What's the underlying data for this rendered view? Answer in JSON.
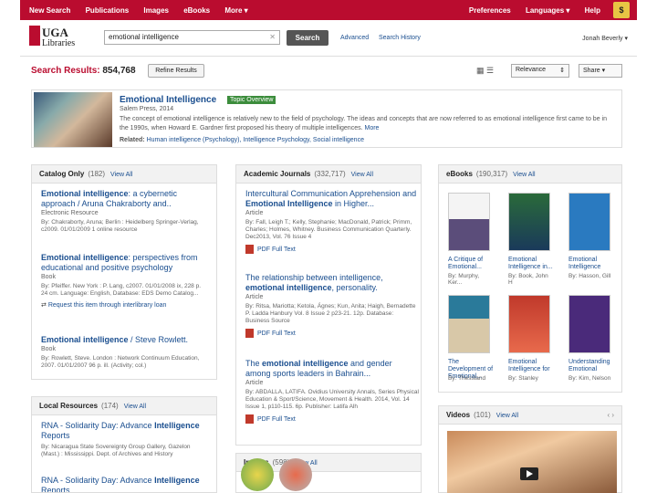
{
  "topnav": {
    "items": [
      "New Search",
      "Publications",
      "Images",
      "eBooks",
      "More ▾"
    ],
    "right": [
      "Preferences",
      "Languages ▾",
      "Help"
    ],
    "cart": "$"
  },
  "header": {
    "logo_line1": "UGA",
    "logo_line2": "Libraries",
    "search_value": "emotional intelligence",
    "search_button": "Search",
    "advanced": "Advanced",
    "history": "Search History",
    "user": "Jonah Beverly"
  },
  "results": {
    "label": "Search Results:",
    "count": "854,768",
    "refine": "Refine Results",
    "sort": "Relevance",
    "share": "Share ▾"
  },
  "topic": {
    "title": "Emotional Intelligence",
    "badge": "Topic Overview",
    "publisher": "Salem Press, 2014",
    "desc": "The concept of emotional intelligence is relatively new to the field of psychology. The ideas and concepts that are now referred to as emotional intelligence first came to be in the 1990s, when Howard E. Gardner first proposed his theory of multiple intelligences.",
    "more": "More",
    "related_label": "Related:",
    "related": "Human intelligence (Psychology), Intelligence Psychology, Social intelligence"
  },
  "catalog": {
    "title": "Catalog Only",
    "count": "(182)",
    "view_all": "View All",
    "items": [
      {
        "title_bold": "Emotional intelligence",
        "title_rest": ": a cybernetic approach / Aruna Chakraborty and..",
        "type": "Electronic Resource",
        "meta": "By: Chakraborty, Aruna; Berlin : Heidelberg Springer-Verlag, c2009. 01/01/2009 1 online resource"
      },
      {
        "title_bold": "Emotional intelligence",
        "title_rest": ": perspectives from educational and positive psychology",
        "type": "Book",
        "meta": "By: Pfeiffer. New York : P. Lang, c2007. 01/01/2008 ix, 228 p. 24 cm. Language: English, Database: EDS Demo Catalog...",
        "action": "Request this item through interlibrary loan"
      },
      {
        "title_bold": "Emotional intelligence",
        "title_rest": " / Steve Rowlett.",
        "type": "Book",
        "meta": "By: Rowlett, Steve. London : Network Continuum Education, 2007. 01/01/2007 96 p. ill. (Activity; col.)"
      }
    ]
  },
  "journals": {
    "title": "Academic Journals",
    "count": "(332,717)",
    "view_all": "View All",
    "items": [
      {
        "title_pre": "Intercultural Communication Apprehension and ",
        "title_bold": "Emotional Intelligence",
        "title_rest": " in Higher...",
        "type": "Article",
        "meta": "By: Fall, Leigh T.; Kelly, Stephanie; MacDonald, Patrick; Primm, Charles; Holmes, Whitney. Business Communication Quarterly. Dec2013, Vol. 76 Issue 4",
        "pdf": "PDF Full Text"
      },
      {
        "title_pre": "The relationship between intelligence, ",
        "title_bold": "emotional intelligence",
        "title_rest": ", personality.",
        "type": "Article",
        "meta": "By: Ritsa, Mariotta; Ketola, Ágnes; Kun, Anita; Haigh, Bernadette P. Ladda Hanbury Vol. 8 Issue 2 p23-21. 12p. Database: Business Source",
        "pdf": "PDF Full Text"
      },
      {
        "title_pre": "The ",
        "title_bold": "emotional intelligence",
        "title_rest": " and gender among sports leaders in Bahrain...",
        "type": "Article",
        "meta": "By: ABDALLA, LATIFA. Ovidius University Annals, Series Physical Education & Sport/Science, Movement & Health. 2014, Vol. 14 Issue 1, p110-115. 6p. Publisher: Latifa Alh",
        "pdf": "PDF Full Text"
      }
    ]
  },
  "ebooks": {
    "title": "eBooks",
    "count": "(190,317)",
    "view_all": "View All",
    "books": [
      {
        "cap": "A Critique of Emotional...",
        "by": "By: Murphy, Ker..."
      },
      {
        "cap": "Emotional Intelligence in...",
        "by": "By: Book, John H"
      },
      {
        "cap": "Emotional Intelligence",
        "by": "By: Hasson, Gill"
      },
      {
        "cap": "The Development of Emotional...",
        "by": "By: Thessland"
      },
      {
        "cap": "Emotional Intelligence for",
        "by": "By: Stanley"
      },
      {
        "cap": "Understanding Emotional",
        "by": "By: Kim, Nelson"
      }
    ]
  },
  "local": {
    "title": "Local Resources",
    "count": "(174)",
    "view_all": "View All",
    "items": [
      {
        "title_pre": "RNA - Solidarity Day: Advance ",
        "title_bold": "Intelligence",
        "title_rest": " Reports",
        "meta": "By: Nicaragua State Sovereignty Group Gallery, Gazelon (Mast.) : Mississippi. Dept. of Archives and History"
      },
      {
        "title_pre": "RNA - Solidarity Day: Advance ",
        "title_bold": "Intelligence",
        "title_rest": " Reports"
      }
    ]
  },
  "videos": {
    "title": "Videos",
    "count": "(101)",
    "view_all": "View All"
  },
  "images": {
    "title": "Images",
    "count": "(598)",
    "view_all": "View All"
  },
  "colors": {
    "brand": "#ba0c2f",
    "link": "#1a4e8f",
    "badge": "#3c8d3c"
  }
}
